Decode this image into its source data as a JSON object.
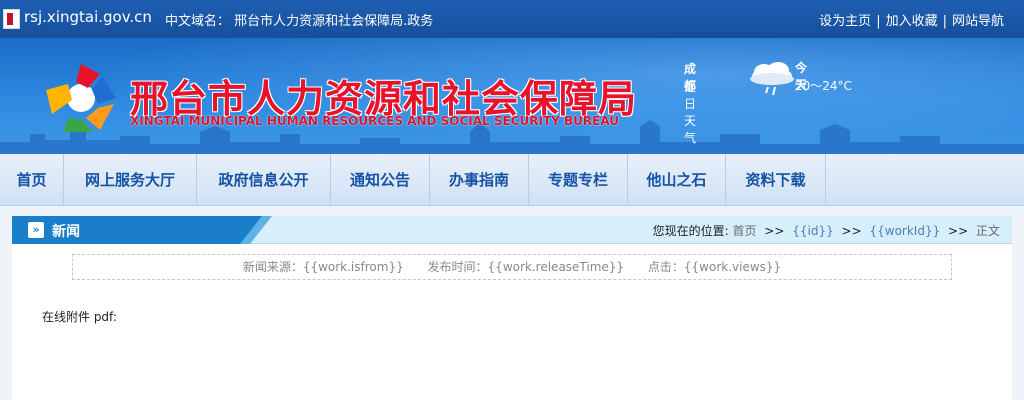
{
  "topbar": {
    "url": "rsj.xingtai.gov.cn",
    "cn_domain": "中文域名：  邢台市人力资源和社会保障局.政务",
    "links": [
      "设为主页",
      "加入收藏",
      "网站导航"
    ],
    "link_separator": "|"
  },
  "banner": {
    "title": "邢台市人力资源和社会保障局",
    "subtitle": "XINGTAI MUNICIPAL HUMAN RESOURCES AND SOCIAL SECURITY BUREAU",
    "weather": {
      "city": "成都",
      "recent_label": "近日天气",
      "today_label": "今天",
      "temperature": "20～24°C",
      "icon": "cloud-rain-icon"
    }
  },
  "nav": {
    "items": [
      "首页",
      "网上服务大厅",
      "政府信息公开",
      "通知公告",
      "办事指南",
      "专题专栏",
      "他山之石",
      "资料下载"
    ]
  },
  "panel": {
    "tab_title": "新闻",
    "breadcrumb": {
      "label": "您现在的位置:",
      "items": [
        "首页",
        "{{id}}",
        "{{workId}}",
        "正文"
      ],
      "separator": ">>"
    },
    "meta": {
      "source": "新闻来源：{{work.isfrom}}",
      "release": "发布时间：{{work.releaseTime}}",
      "views": "点击：{{work.views}}"
    },
    "attachment_label": "在线附件 pdf:"
  },
  "colors": {
    "topbar": "#1a57a8",
    "title_red": "#e8132b",
    "nav_text": "#1652a5",
    "tab_blue": "#1a7ec9"
  }
}
